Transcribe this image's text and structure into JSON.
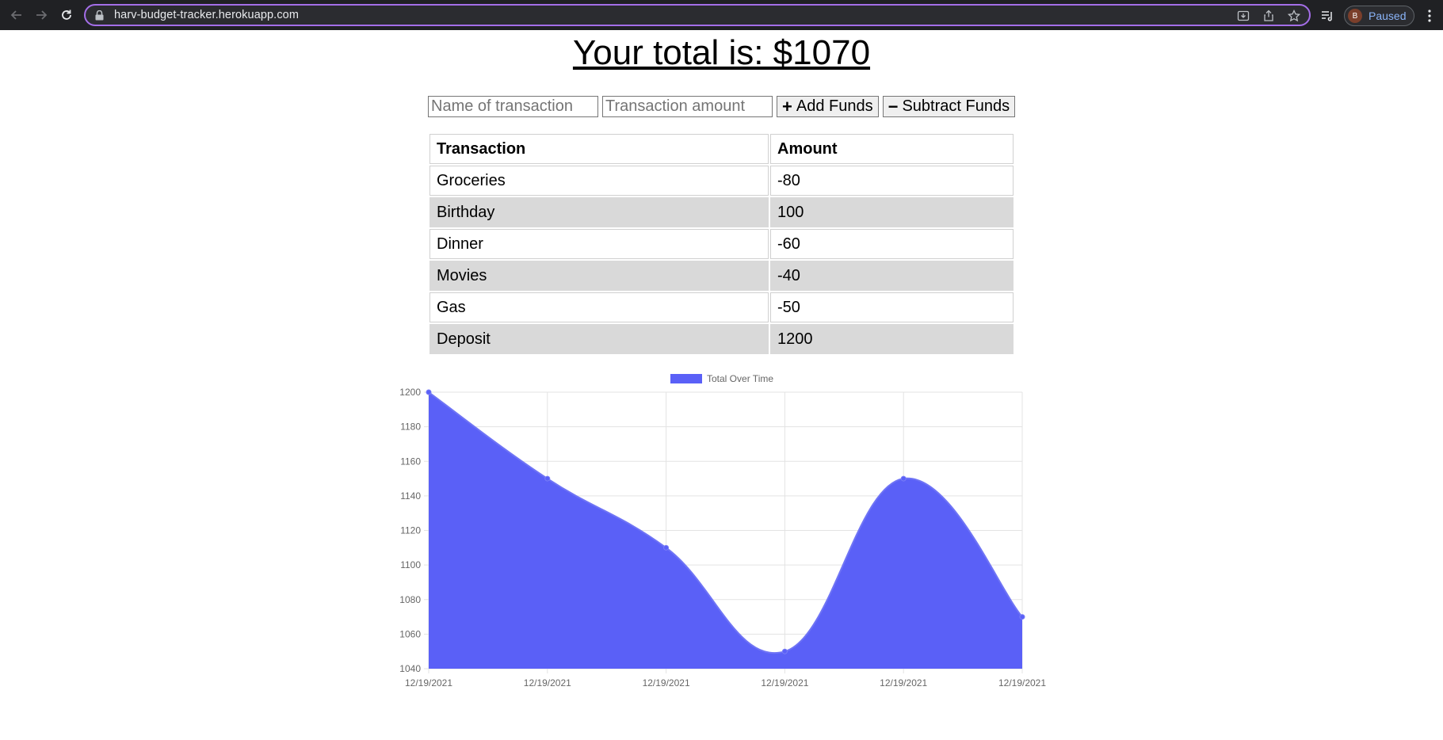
{
  "browser": {
    "url": "harv-budget-tracker.herokuapp.com",
    "profile_initial": "B",
    "profile_status": "Paused",
    "accent_color": "#a46ee8"
  },
  "page": {
    "total_text": "Your total is: $1070"
  },
  "form": {
    "name_placeholder": "Name of transaction",
    "amount_placeholder": "Transaction amount",
    "add_label": "Add Funds",
    "subtract_label": "Subtract Funds"
  },
  "table": {
    "headers": [
      "Transaction",
      "Amount"
    ],
    "rows": [
      [
        "Groceries",
        "-80"
      ],
      [
        "Birthday",
        "100"
      ],
      [
        "Dinner",
        "-60"
      ],
      [
        "Movies",
        "-40"
      ],
      [
        "Gas",
        "-50"
      ],
      [
        "Deposit",
        "1200"
      ]
    ]
  },
  "chart_data": {
    "type": "area",
    "legend": [
      "Total Over Time"
    ],
    "legend_position": "top-center",
    "fill_color": "#5a60f7",
    "x": [
      "12/19/2021",
      "12/19/2021",
      "12/19/2021",
      "12/19/2021",
      "12/19/2021",
      "12/19/2021"
    ],
    "series": [
      {
        "name": "Total Over Time",
        "values": [
          1200,
          1150,
          1110,
          1050,
          1150,
          1070
        ]
      }
    ],
    "ylim": [
      1040,
      1200
    ],
    "yticks": [
      1040,
      1060,
      1080,
      1100,
      1120,
      1140,
      1160,
      1180,
      1200
    ],
    "grid": true
  }
}
